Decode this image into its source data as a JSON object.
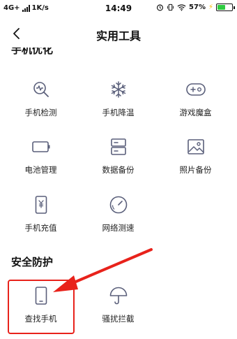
{
  "status_bar": {
    "network": "4G+",
    "speed": "1K/s",
    "time": "14:49",
    "battery": "57%",
    "battery_level": 0.57
  },
  "header": {
    "title": "实用工具"
  },
  "section_phone": {
    "title": "手机优化",
    "items": [
      {
        "label": "手机检测",
        "icon": "magnifier-chart-icon"
      },
      {
        "label": "手机降温",
        "icon": "snowflake-icon"
      },
      {
        "label": "游戏魔盒",
        "icon": "gamepad-icon"
      },
      {
        "label": "电池管理",
        "icon": "battery-icon"
      },
      {
        "label": "数据备份",
        "icon": "database-icon"
      },
      {
        "label": "照片备份",
        "icon": "photo-icon"
      },
      {
        "label": "手机充值",
        "icon": "phone-yuan-icon"
      },
      {
        "label": "网络测速",
        "icon": "speedometer-icon"
      }
    ]
  },
  "section_security": {
    "title": "安全防护",
    "items": [
      {
        "label": "查找手机",
        "icon": "phone-icon"
      },
      {
        "label": "骚扰拦截",
        "icon": "umbrella-icon"
      }
    ]
  },
  "colors": {
    "icon_stroke": "#5a5f7a",
    "annotation_red": "#e8221b",
    "battery_green": "#2ecc40"
  }
}
